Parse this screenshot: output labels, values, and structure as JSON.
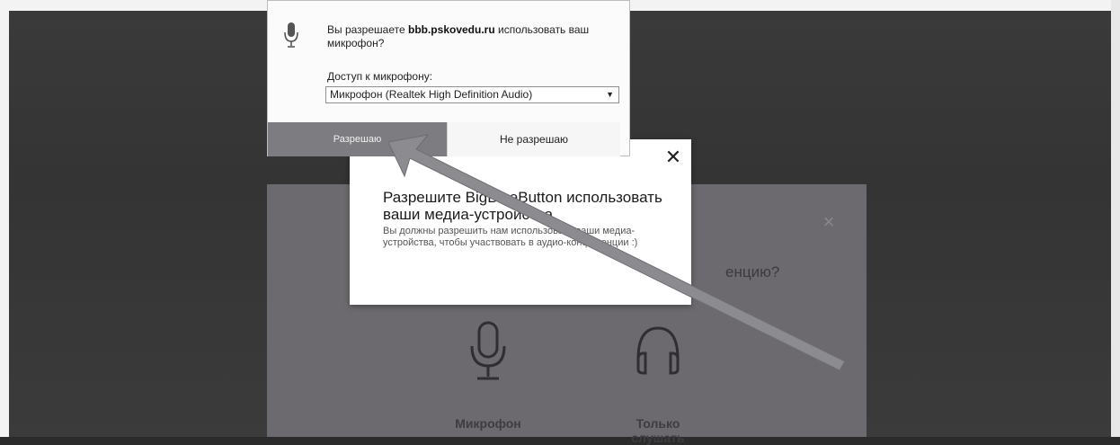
{
  "browser_prompt": {
    "question_prefix": "Вы разрешаете ",
    "site": "bbb.pskovedu.ru",
    "question_suffix": " использовать ваш микрофон?",
    "access_label": "Доступ к микрофону:",
    "device_selected": "Микрофон (Realtek High Definition Audio)",
    "allow_label": "Разрешаю",
    "deny_label": "Не разрешаю"
  },
  "permission_dialog": {
    "title": "Разрешите BigBlueButton использовать ваши медиа-устройства",
    "description": "Вы должны разрешить нам использовать ваши медиа-устройства, чтобы участвовать в аудио-конференции :)",
    "close_glyph": "✕"
  },
  "audio_dialog": {
    "question_tail": "енцию?",
    "close_glyph": "×",
    "options": [
      {
        "label": "Микрофон",
        "icon": "microphone-icon"
      },
      {
        "label": "Только слушать",
        "icon": "headphones-icon"
      }
    ]
  },
  "colors": {
    "allow_button": "#7d7c80",
    "overlay": "#3a3a3a",
    "audio_modal": "#6c6a6e",
    "annotation_arrow": "#8c8c90"
  }
}
